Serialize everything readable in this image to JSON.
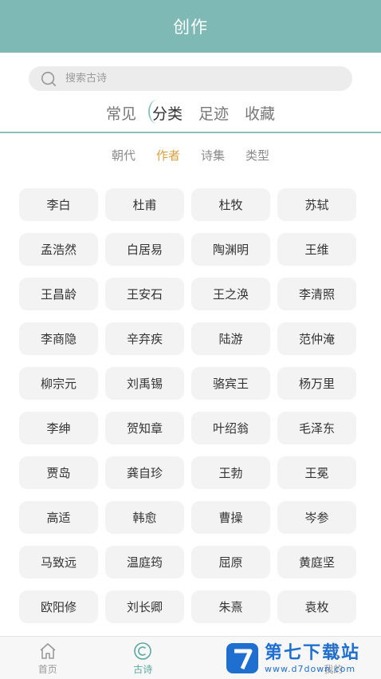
{
  "header": {
    "title": "创作"
  },
  "search": {
    "placeholder": "搜索古诗"
  },
  "main_tabs": [
    {
      "label": "常见",
      "active": false
    },
    {
      "label": "分类",
      "active": true
    },
    {
      "label": "足迹",
      "active": false
    },
    {
      "label": "收藏",
      "active": false
    }
  ],
  "sub_tabs": [
    {
      "label": "朝代",
      "active": false
    },
    {
      "label": "作者",
      "active": true
    },
    {
      "label": "诗集",
      "active": false
    },
    {
      "label": "类型",
      "active": false
    }
  ],
  "authors": [
    "李白",
    "杜甫",
    "杜牧",
    "苏轼",
    "孟浩然",
    "白居易",
    "陶渊明",
    "王维",
    "王昌龄",
    "王安石",
    "王之涣",
    "李清照",
    "李商隐",
    "辛弃疾",
    "陆游",
    "范仲淹",
    "柳宗元",
    "刘禹锡",
    "骆宾王",
    "杨万里",
    "李绅",
    "贺知章",
    "叶绍翁",
    "毛泽东",
    "贾岛",
    "龚自珍",
    "王勃",
    "王冕",
    "高适",
    "韩愈",
    "曹操",
    "岑参",
    "马致远",
    "温庭筠",
    "屈原",
    "黄庭坚",
    "欧阳修",
    "刘长卿",
    "朱熹",
    "袁枚"
  ],
  "bottom_nav": [
    {
      "label": "首页",
      "icon": "home-icon",
      "active": false
    },
    {
      "label": "古诗",
      "icon": "poem-icon",
      "active": true
    },
    {
      "label": "",
      "icon": "create-icon",
      "active": false
    },
    {
      "label": "我的",
      "icon": "profile-icon",
      "active": false
    }
  ],
  "watermark": {
    "title": "第七下载站",
    "url": "www.d7down.com"
  },
  "colors": {
    "header": "#7fb9b6",
    "accent": "#d6a23f",
    "nav_active": "#5aa7a2"
  }
}
